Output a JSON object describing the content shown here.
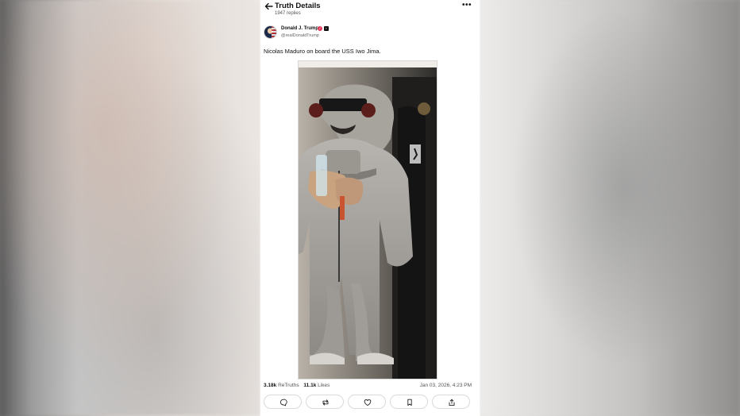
{
  "header": {
    "title": "Truth Details",
    "replies": "1947 replies",
    "more": "•••",
    "back_icon": "back-arrow-icon"
  },
  "post": {
    "author_name": "Donald J. Trump",
    "handle": "@realDonaldTrump",
    "verified_icon": "verified-badge-icon",
    "secondary_badge_icon": "truth-badge-icon",
    "text": "Nicolas Maduro on board the USS Iwo Jima.",
    "image_alt_icon": "photo-image"
  },
  "stats": {
    "retruths_count": "3.18k",
    "retruths_label": "ReTruths",
    "likes_count": "11.1k",
    "likes_label": "Likes",
    "timestamp": "Jan 03, 2026, 4:23 PM"
  },
  "actions": [
    {
      "icon": "reply-icon"
    },
    {
      "icon": "retruth-icon"
    },
    {
      "icon": "like-icon"
    },
    {
      "icon": "bookmark-icon"
    },
    {
      "icon": "share-icon"
    }
  ]
}
